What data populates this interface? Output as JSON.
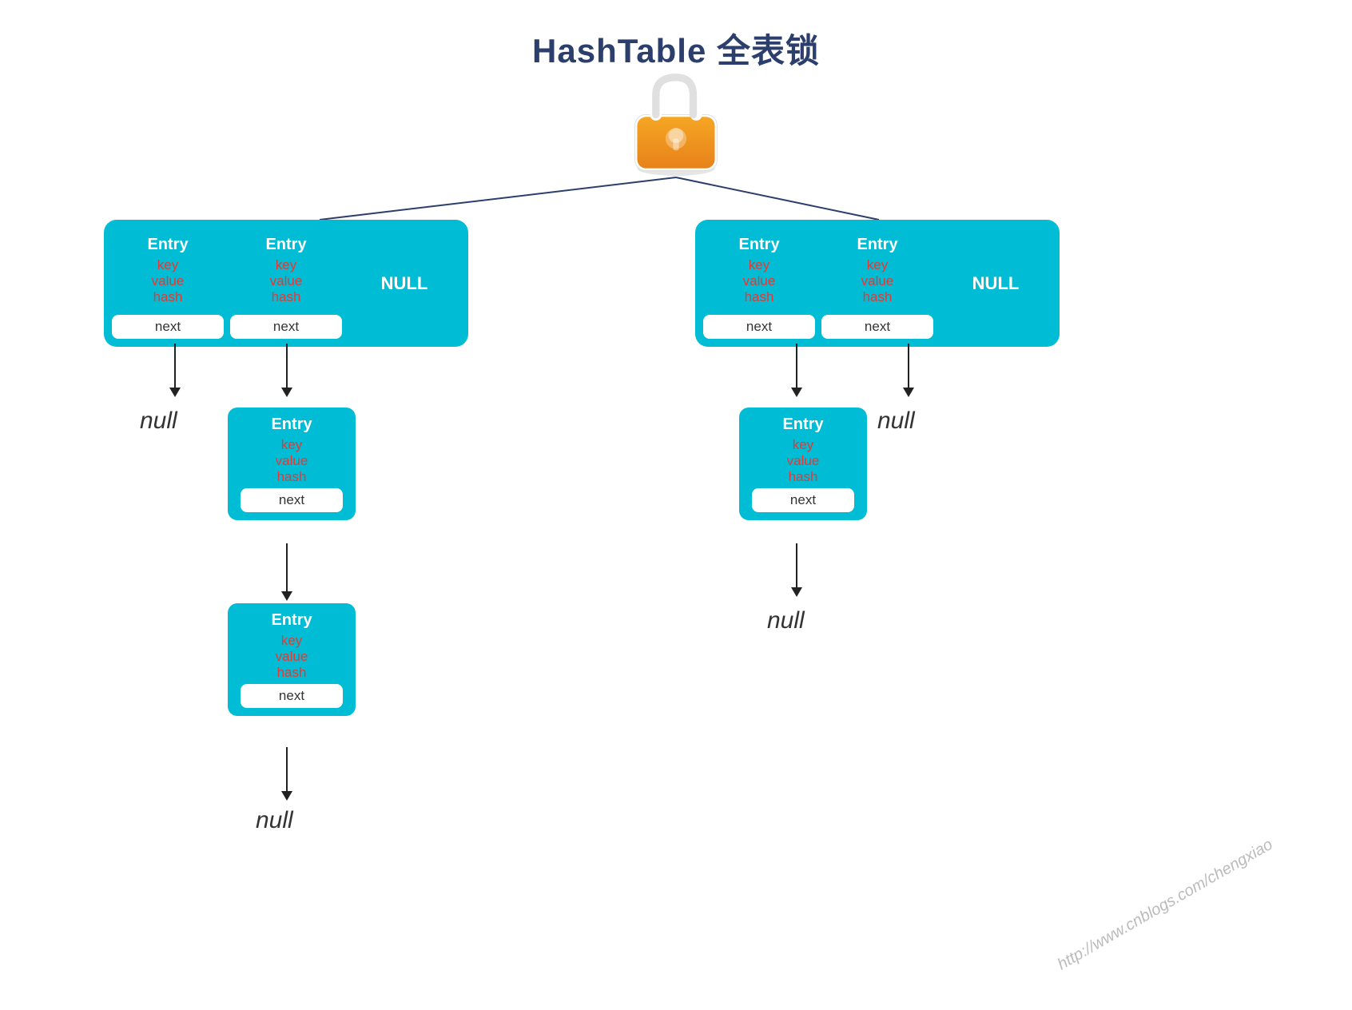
{
  "title": "HashTable 全表锁",
  "watermark": "http://www.cnblogs.com/chengxiao",
  "table_row1": {
    "cells": [
      {
        "type": "entry",
        "label": "Entry",
        "key": "key",
        "value": "value",
        "hash": "hash",
        "next": "next"
      },
      {
        "type": "entry",
        "label": "Entry",
        "key": "key",
        "value": "value",
        "hash": "hash",
        "next": "next"
      },
      {
        "type": "null",
        "label": "NULL"
      },
      {
        "type": "entry",
        "label": "Entry",
        "key": "key",
        "value": "value",
        "hash": "hash",
        "next": "next"
      },
      {
        "type": "entry",
        "label": "Entry",
        "key": "key",
        "value": "value",
        "hash": "hash",
        "next": "next"
      },
      {
        "type": "null",
        "label": "NULL"
      }
    ]
  },
  "level2_left": {
    "label": "Entry",
    "key": "key",
    "value": "value",
    "hash": "hash",
    "next": "next"
  },
  "level2_right": {
    "label": "Entry",
    "key": "key",
    "value": "value",
    "hash": "hash",
    "next": "next"
  },
  "level3_left": {
    "label": "Entry",
    "key": "key",
    "value": "value",
    "hash": "hash",
    "next": "next"
  },
  "nulls": [
    "null",
    "null",
    "null",
    "null"
  ],
  "labels": {
    "entry": "Entry",
    "key": "key",
    "value": "value",
    "hash": "hash",
    "next": "next",
    "null_cell": "NULL",
    "null_text": "null"
  }
}
